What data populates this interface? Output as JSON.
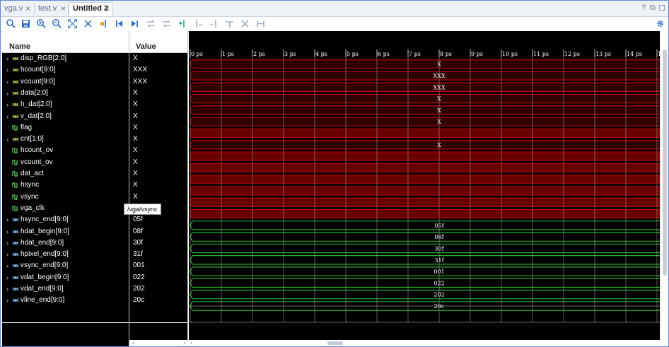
{
  "tabs": [
    {
      "label": "vga.v"
    },
    {
      "label": "test.v"
    },
    {
      "label": "Untitled 2"
    }
  ],
  "window_buttons": {
    "help": "?",
    "restore": "⧉",
    "maximize": "☐"
  },
  "headers": {
    "name": "Name",
    "value": "Value"
  },
  "tooltip": "/vga/vsync",
  "time_ticks": [
    "0 ps",
    "1 ps",
    "2 ps",
    "3 ps",
    "4 ps",
    "5 ps",
    "6 ps",
    "7 ps",
    "8 ps",
    "9 ps",
    "10 ps",
    "11 ps",
    "12 ps",
    "13 ps",
    "14 ps",
    "1"
  ],
  "signals": [
    {
      "name": "disp_RGB[2:0]",
      "value": "X",
      "kind": "bus",
      "expandable": true,
      "wave": "X",
      "color": "#c00000"
    },
    {
      "name": "hcount[9:0]",
      "value": "XXX",
      "kind": "bus",
      "expandable": true,
      "wave": "XXX",
      "color": "#c00000"
    },
    {
      "name": "vcount[9:0]",
      "value": "XXX",
      "kind": "bus",
      "expandable": true,
      "wave": "XXX",
      "color": "#c00000"
    },
    {
      "name": "data[2:0]",
      "value": "X",
      "kind": "bus",
      "expandable": true,
      "wave": "X",
      "color": "#c00000"
    },
    {
      "name": "h_dat[2:0]",
      "value": "X",
      "kind": "bus",
      "expandable": true,
      "wave": "X",
      "color": "#c00000"
    },
    {
      "name": "v_dat[2:0]",
      "value": "X",
      "kind": "bus",
      "expandable": true,
      "wave": "X",
      "color": "#c00000"
    },
    {
      "name": "flag",
      "value": "X",
      "kind": "bit",
      "expandable": false,
      "wave": "",
      "color": "#c00000"
    },
    {
      "name": "cnt[1:0]",
      "value": "X",
      "kind": "bus",
      "expandable": true,
      "wave": "X",
      "color": "#c00000"
    },
    {
      "name": "hcount_ov",
      "value": "X",
      "kind": "bit",
      "expandable": false,
      "wave": "",
      "color": "#c00000"
    },
    {
      "name": "vcount_ov",
      "value": "X",
      "kind": "bit",
      "expandable": false,
      "wave": "",
      "color": "#c00000"
    },
    {
      "name": "dat_act",
      "value": "X",
      "kind": "bit",
      "expandable": false,
      "wave": "",
      "color": "#c00000"
    },
    {
      "name": "hsync",
      "value": "X",
      "kind": "bit",
      "expandable": false,
      "wave": "",
      "color": "#c00000"
    },
    {
      "name": "vsync",
      "value": "X",
      "kind": "bit",
      "expandable": false,
      "wave": "",
      "color": "#c00000"
    },
    {
      "name": "vga_clk",
      "value": "",
      "kind": "bit",
      "expandable": false,
      "wave": "",
      "color": "#c00000"
    },
    {
      "name": "hsync_end[9:0]",
      "value": "05f",
      "kind": "param",
      "expandable": true,
      "wave": "05f",
      "color": "#2bb02b"
    },
    {
      "name": "hdat_begin[9:0]",
      "value": "08f",
      "kind": "param",
      "expandable": true,
      "wave": "08f",
      "color": "#2bb02b"
    },
    {
      "name": "hdat_end[9:0]",
      "value": "30f",
      "kind": "param",
      "expandable": true,
      "wave": "30f",
      "color": "#2bb02b"
    },
    {
      "name": "hpixel_end[9:0]",
      "value": "31f",
      "kind": "param",
      "expandable": true,
      "wave": "31f",
      "color": "#2bb02b"
    },
    {
      "name": "vsync_end[9:0]",
      "value": "001",
      "kind": "param",
      "expandable": true,
      "wave": "001",
      "color": "#2bb02b"
    },
    {
      "name": "vdat_begin[9:0]",
      "value": "022",
      "kind": "param",
      "expandable": true,
      "wave": "022",
      "color": "#2bb02b"
    },
    {
      "name": "vdat_end[9:0]",
      "value": "202",
      "kind": "param",
      "expandable": true,
      "wave": "202",
      "color": "#2bb02b"
    },
    {
      "name": "vline_end[9:0]",
      "value": "20c",
      "kind": "param",
      "expandable": true,
      "wave": "20c",
      "color": "#2bb02b"
    }
  ],
  "toolbar_icons": [
    "search-icon",
    "save-icon",
    "zoom-in-icon",
    "zoom-out-icon",
    "zoom-fit-icon",
    "cursor-icon",
    "marker-icon",
    "go-to-start-icon",
    "go-to-end-icon",
    "swap-icon",
    "swap-alt-icon",
    "add-marker-icon",
    "prev-marker-icon",
    "next-marker-icon",
    "marker-end-icon",
    "delete-icon",
    "full-range-icon"
  ],
  "settings_icon": "gear-icon",
  "colors": {
    "x_state": "#c00000",
    "param": "#2bb02b",
    "accent": "#2d6cc0"
  }
}
